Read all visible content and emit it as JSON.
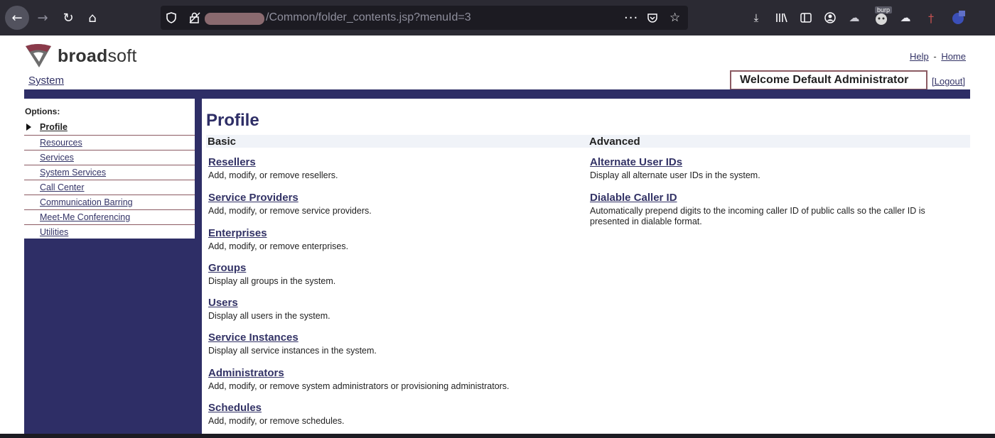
{
  "browser": {
    "url_path": "/Common/folder_contents.jsp?menuId=3",
    "icons": [
      "back-arrow-icon",
      "forward-arrow-icon",
      "reload-icon",
      "home-icon",
      "shield-icon",
      "lock-icon",
      "more-icon",
      "pocket-icon",
      "bookmark-star-icon",
      "download-icon",
      "library-icon",
      "sidebar-icon",
      "account-icon",
      "extension-icon",
      "burp-icon",
      "container-icon",
      "extension-icon",
      "extension-icon"
    ],
    "badge": "burp"
  },
  "header": {
    "logo_text_bold": "broad",
    "logo_text_rest": "soft",
    "help_link": "Help",
    "separator": "-",
    "home_link": "Home",
    "system_link": "System",
    "welcome": "Welcome Default Administrator",
    "logout_link": "[Logout]"
  },
  "sidebar": {
    "title": "Options:",
    "items": [
      {
        "label": "Profile",
        "active": true
      },
      {
        "label": "Resources"
      },
      {
        "label": "Services"
      },
      {
        "label": "System Services"
      },
      {
        "label": "Call Center"
      },
      {
        "label": "Communication Barring"
      },
      {
        "label": "Meet-Me Conferencing"
      },
      {
        "label": "Utilities"
      }
    ]
  },
  "main": {
    "title": "Profile",
    "basic": {
      "heading": "Basic",
      "entries": [
        {
          "title": "Resellers",
          "desc": "Add, modify, or remove resellers."
        },
        {
          "title": "Service Providers",
          "desc": "Add, modify, or remove service providers."
        },
        {
          "title": "Enterprises",
          "desc": "Add, modify, or remove enterprises."
        },
        {
          "title": "Groups",
          "desc": "Display all groups in the system."
        },
        {
          "title": "Users",
          "desc": "Display all users in the system."
        },
        {
          "title": "Service Instances",
          "desc": "Display all service instances in the system."
        },
        {
          "title": "Administrators",
          "desc": "Add, modify, or remove system administrators or provisioning administrators."
        },
        {
          "title": "Schedules",
          "desc": "Add, modify, or remove schedules."
        }
      ]
    },
    "advanced": {
      "heading": "Advanced",
      "entries": [
        {
          "title": "Alternate User IDs",
          "desc": "Display all alternate user IDs in the system."
        },
        {
          "title": "Dialable Caller ID",
          "desc": "Automatically prepend digits to the incoming caller ID of public calls so the caller ID is presented in dialable format."
        }
      ]
    }
  },
  "colors": {
    "navy": "#2e2e66",
    "link": "#333366",
    "accent_border": "#8b5a62"
  }
}
